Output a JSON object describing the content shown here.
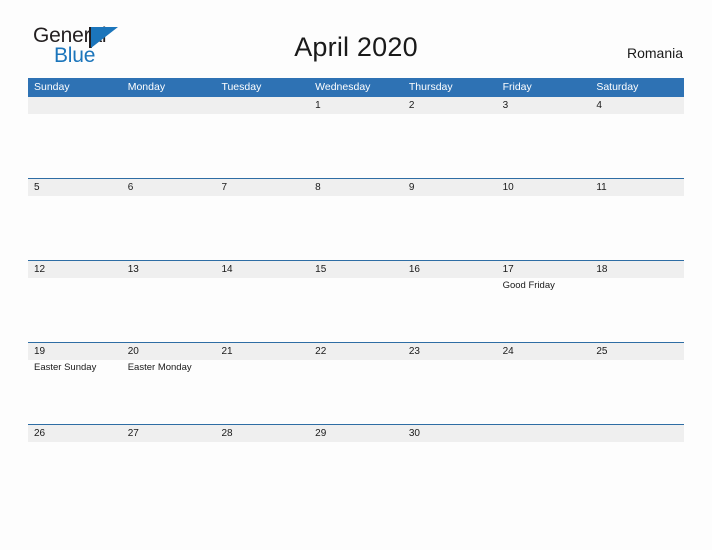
{
  "logo": {
    "word_dark": "General",
    "word_blue": "Blue",
    "dark_color": "#231f20",
    "blue_color": "#1b75bb"
  },
  "header": {
    "title": "April 2020",
    "region": "Romania"
  },
  "theme": {
    "header_blue": "#2e72b4",
    "rule_blue": "#2e6da4",
    "band_gray": "#efefef",
    "page_bg": "#fdfdfd",
    "text": "#1a1a1a"
  },
  "calendar": {
    "weekdays": [
      "Sunday",
      "Monday",
      "Tuesday",
      "Wednesday",
      "Thursday",
      "Friday",
      "Saturday"
    ],
    "weeks": [
      {
        "days": [
          {
            "num": "",
            "holiday": ""
          },
          {
            "num": "",
            "holiday": ""
          },
          {
            "num": "",
            "holiday": ""
          },
          {
            "num": "1",
            "holiday": ""
          },
          {
            "num": "2",
            "holiday": ""
          },
          {
            "num": "3",
            "holiday": ""
          },
          {
            "num": "4",
            "holiday": ""
          }
        ]
      },
      {
        "days": [
          {
            "num": "5",
            "holiday": ""
          },
          {
            "num": "6",
            "holiday": ""
          },
          {
            "num": "7",
            "holiday": ""
          },
          {
            "num": "8",
            "holiday": ""
          },
          {
            "num": "9",
            "holiday": ""
          },
          {
            "num": "10",
            "holiday": ""
          },
          {
            "num": "11",
            "holiday": ""
          }
        ]
      },
      {
        "days": [
          {
            "num": "12",
            "holiday": ""
          },
          {
            "num": "13",
            "holiday": ""
          },
          {
            "num": "14",
            "holiday": ""
          },
          {
            "num": "15",
            "holiday": ""
          },
          {
            "num": "16",
            "holiday": ""
          },
          {
            "num": "17",
            "holiday": "Good Friday"
          },
          {
            "num": "18",
            "holiday": ""
          }
        ]
      },
      {
        "days": [
          {
            "num": "19",
            "holiday": "Easter Sunday"
          },
          {
            "num": "20",
            "holiday": "Easter Monday"
          },
          {
            "num": "21",
            "holiday": ""
          },
          {
            "num": "22",
            "holiday": ""
          },
          {
            "num": "23",
            "holiday": ""
          },
          {
            "num": "24",
            "holiday": ""
          },
          {
            "num": "25",
            "holiday": ""
          }
        ]
      },
      {
        "days": [
          {
            "num": "26",
            "holiday": ""
          },
          {
            "num": "27",
            "holiday": ""
          },
          {
            "num": "28",
            "holiday": ""
          },
          {
            "num": "29",
            "holiday": ""
          },
          {
            "num": "30",
            "holiday": ""
          },
          {
            "num": "",
            "holiday": ""
          },
          {
            "num": "",
            "holiday": ""
          }
        ]
      }
    ]
  }
}
